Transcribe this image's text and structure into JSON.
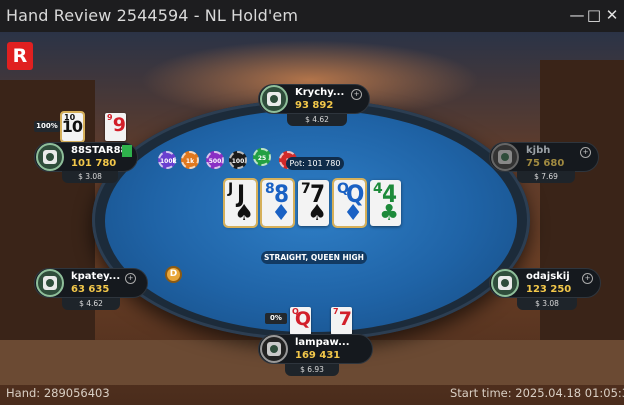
{
  "window": {
    "title": "Hand Review 2544594 - NL Hold'em",
    "minimize_icon": "—",
    "maximize_icon": "□",
    "close_icon": "✕"
  },
  "logo": {
    "text": "R",
    "color": "#e02020"
  },
  "table": {
    "pot_text": "Pot: 101 780",
    "hand_result": "STRAIGHT, QUEEN HIGH",
    "dealer_button": "D",
    "felt_color": "#1f63a6"
  },
  "chips": [
    {
      "label": "100k",
      "color": "#6a3fcf"
    },
    {
      "label": "1k",
      "color": "#e0781e"
    },
    {
      "label": "500",
      "color": "#8a2fc4"
    },
    {
      "label": "100",
      "color": "#1b1b1b"
    },
    {
      "label": "25",
      "color": "#23a043"
    },
    {
      "label": "5",
      "color": "#d12a2a"
    }
  ],
  "board": [
    {
      "rank": "J",
      "suit": "♠",
      "color": "blk"
    },
    {
      "rank": "8",
      "suit": "♦",
      "color": "blu"
    },
    {
      "rank": "7",
      "suit": "♠",
      "color": "blk"
    },
    {
      "rank": "Q",
      "suit": "♦",
      "color": "blu"
    },
    {
      "rank": "4",
      "suit": "♣",
      "color": "grn"
    }
  ],
  "seats": [
    {
      "name": "Krychy...",
      "stack": "93 892",
      "balance": "$ 4.62"
    },
    {
      "name": "kjbh",
      "stack": "75 680",
      "balance": "$ 7.69"
    },
    {
      "name": "odajskij",
      "stack": "123 250",
      "balance": "$ 3.08"
    },
    {
      "name": "lampaw...",
      "stack": "169 431",
      "balance": "$ 6.93",
      "equity": "0%",
      "cards": [
        {
          "rank": "Q",
          "color": "red"
        },
        {
          "rank": "7",
          "color": "red"
        }
      ]
    },
    {
      "name": "kpatey...",
      "stack": "63 635",
      "balance": "$ 4.62"
    },
    {
      "name": "88STAR88",
      "stack": "101 780",
      "balance": "$ 3.08",
      "equity": "100%",
      "cards": [
        {
          "rank": "10",
          "color": "blk"
        },
        {
          "rank": "9",
          "color": "red"
        }
      ]
    }
  ],
  "footer": {
    "hand_number": "Hand: 289056403",
    "start_time": "Start time: 2025.04.18 01:05:30"
  }
}
